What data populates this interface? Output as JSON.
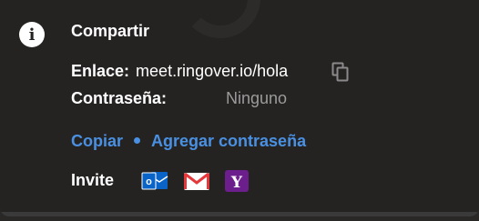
{
  "share": {
    "title": "Compartir",
    "link_label": "Enlace:",
    "link_value": "meet.ringover.io/hola",
    "password_label": "Contraseña:",
    "password_value": "Ninguno",
    "copy_action": "Copiar",
    "add_password_action": "Agregar contraseña",
    "invite_label": "Invite",
    "invite_services": [
      "outlook-icon",
      "gmail-icon",
      "yahoo-icon"
    ]
  },
  "colors": {
    "panel_bg": "#252322",
    "link_accent": "#4a90e2",
    "muted_text": "#9b9b9b",
    "outlook_blue": "#0a64c8",
    "gmail_red": "#e5383b",
    "yahoo_purple": "#6b1e8c"
  }
}
